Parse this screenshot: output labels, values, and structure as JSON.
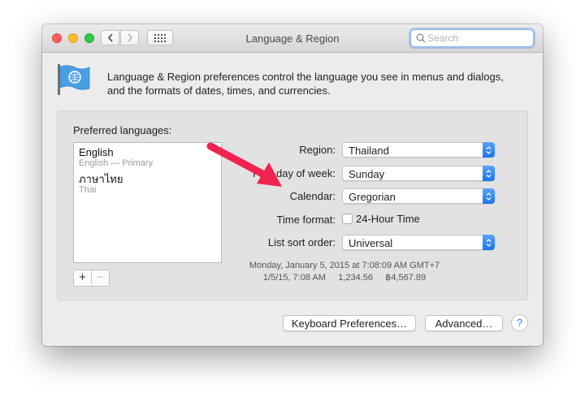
{
  "window": {
    "title": "Language & Region",
    "search": {
      "placeholder": "Search",
      "value": ""
    }
  },
  "description": "Language & Region preferences control the language you see in menus and dialogs, and the formats of dates, times, and currencies.",
  "preferred_languages": {
    "label": "Preferred languages:",
    "items": [
      {
        "name": "English",
        "detail": "English — Primary"
      },
      {
        "name": "ภาษาไทย",
        "detail": "Thai"
      }
    ],
    "add_label": "+",
    "remove_label": "−"
  },
  "settings": {
    "region": {
      "label": "Region:",
      "value": "Thailand"
    },
    "first_day": {
      "label": "First day of week:",
      "value": "Sunday"
    },
    "calendar": {
      "label": "Calendar:",
      "value": "Gregorian"
    },
    "time_format": {
      "label": "Time format:",
      "checkbox_label": "24-Hour Time",
      "checked": false
    },
    "sort_order": {
      "label": "List sort order:",
      "value": "Universal"
    }
  },
  "sample": {
    "line1": "Monday, January 5, 2015 at 7:08:09 AM GMT+7",
    "line2": "1/5/15, 7:08 AM     1,234.56     ฿4,567.89"
  },
  "buttons": {
    "keyboard": "Keyboard Preferences…",
    "advanced": "Advanced…",
    "help": "?"
  },
  "colors": {
    "annotation_arrow": "#f0234f",
    "stepper_blue": "#1874ed"
  },
  "icons": {
    "flag": "un-flag-icon",
    "search": "search-icon",
    "back": "chevron-left-icon",
    "forward": "chevron-right-icon",
    "grid": "grid-icon"
  }
}
